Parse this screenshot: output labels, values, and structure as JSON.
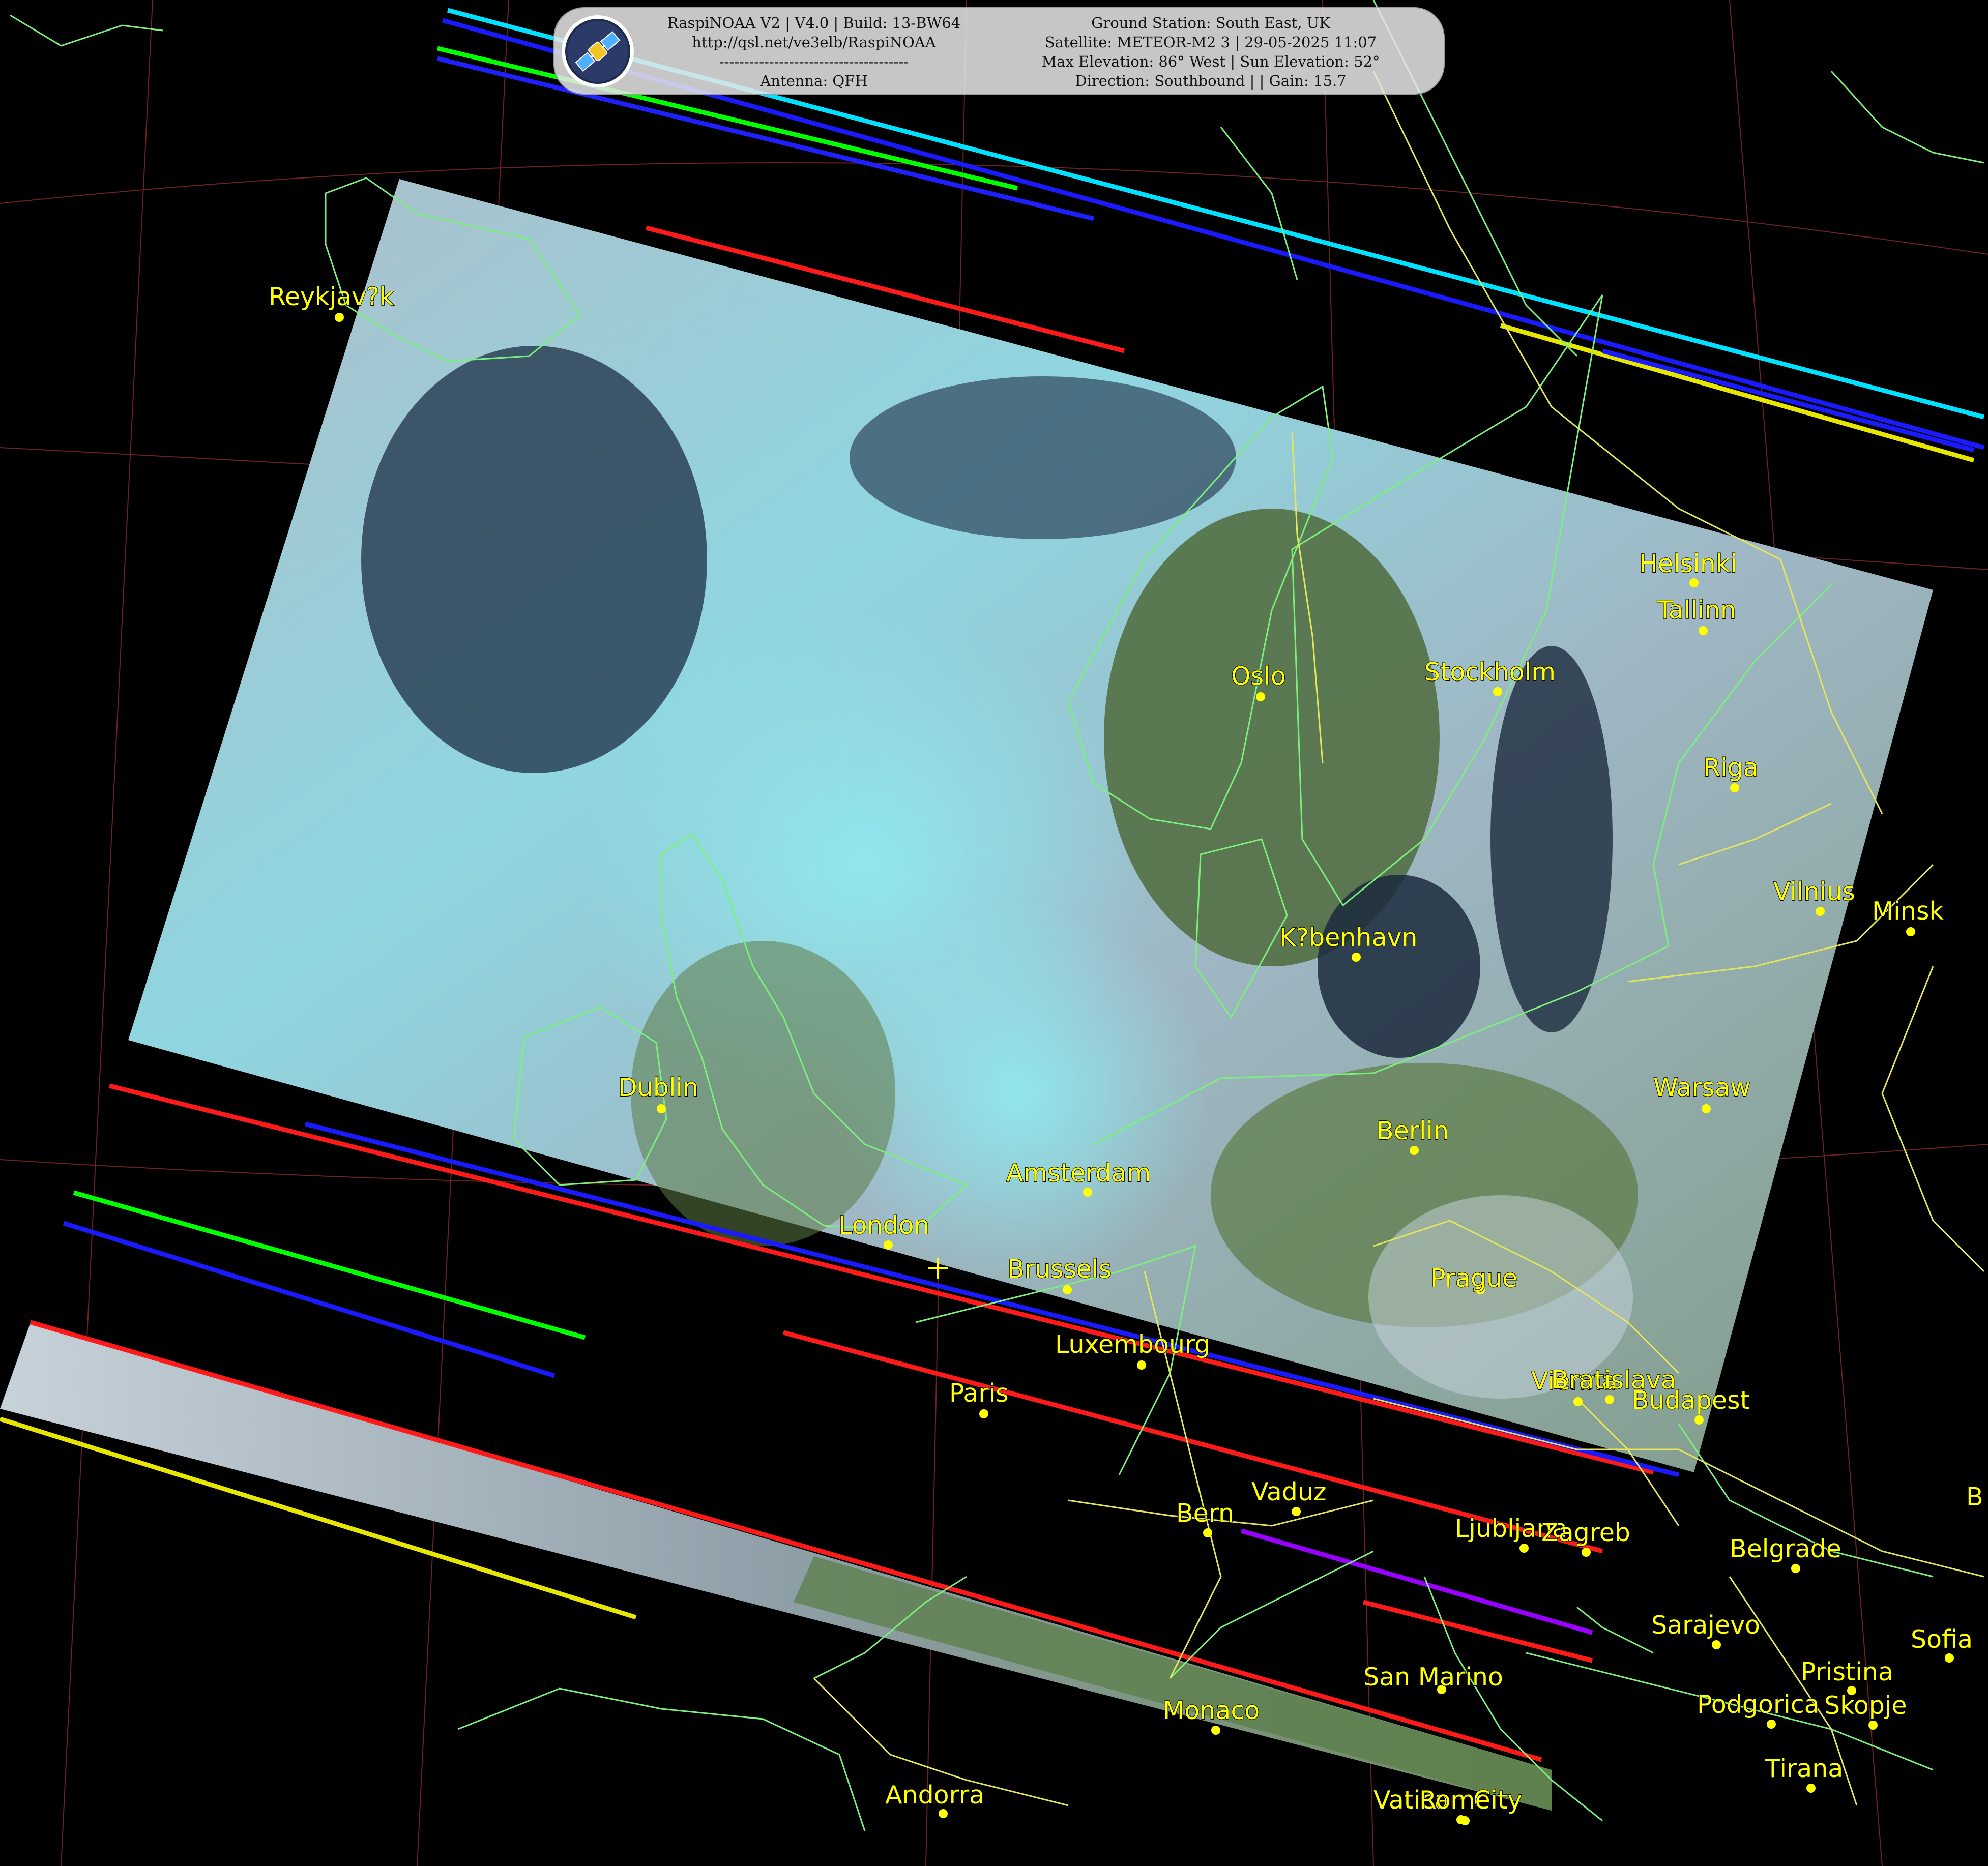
{
  "banner": {
    "left_lines": [
      "RaspiNOAA V2 | V4.0 | Build: 13-BW64",
      "http://qsl.net/ve3elb/RaspiNOAA",
      "--------------------------------------",
      "Antenna: QFH"
    ],
    "right_lines": [
      "Ground Station: South East, UK",
      "Satellite: METEOR-M2 3 | 29-05-2025 11:07",
      "Max Elevation: 86° West | Sun Elevation: 52°",
      "Direction: Southbound | | Gain: 15.7"
    ],
    "logo_icon": "satellite-icon"
  },
  "cities": [
    "Reykjav?k",
    "Helsinki",
    "Tallinn",
    "Oslo",
    "Stockholm",
    "Riga",
    "Vilnius",
    "Minsk",
    "K?benhavn",
    "Dublin",
    "Warsaw",
    "Berlin",
    "Amsterdam",
    "London",
    "Brussels",
    "Prague",
    "Luxembourg",
    "Paris",
    "Vienna",
    "Bratislava",
    "Budapest",
    "Vaduz",
    "Bern",
    "Ljubljana",
    "Zagreb",
    "Belgrade",
    "B",
    "Sarajevo",
    "Sofia",
    "San Marino",
    "Pristina",
    "Podgorica",
    "Skopje",
    "Monaco",
    "Tirana",
    "Andorra",
    "Vatican City",
    "Rome"
  ],
  "colors": {
    "background": "#000000",
    "label": "#ffff00",
    "coastline": "#7cf07c",
    "border": "#e6e65a",
    "graticule": "#8b2a2a",
    "cloud": "#c9d6df",
    "cloud_cyan": "#7fe0e6",
    "sea": "#1b2a3d",
    "land": "#4f6b3c"
  }
}
